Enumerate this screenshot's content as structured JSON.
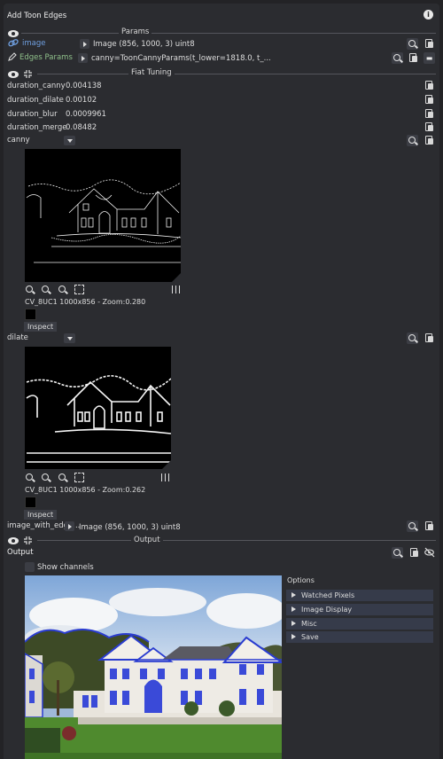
{
  "window": {
    "title": "Add Toon Edges"
  },
  "sections": {
    "params": "Params",
    "fiat_tuning": "Fiat Tuning",
    "output": "Output"
  },
  "params": [
    {
      "label": "image",
      "value": "Image (856, 1000, 3) uint8"
    },
    {
      "label": "Edges Params",
      "value": "canny=ToonCannyParams(t_lower=1818.0, t_..."
    }
  ],
  "tuning": [
    {
      "label": "duration_canny",
      "value": "0.004138"
    },
    {
      "label": "duration_dilate",
      "value": "0.00102"
    },
    {
      "label": "duration_blur",
      "value": "0.0009961"
    },
    {
      "label": "duration_merge",
      "value": "0.08482"
    }
  ],
  "canny": {
    "label": "canny",
    "info": "CV_8UC1 1000x856 - Zoom:0.280",
    "inspect": "Inspect"
  },
  "dilate": {
    "label": "dilate",
    "info": "CV_8UC1 1000x856 - Zoom:0.262",
    "inspect": "Inspect"
  },
  "image_with_edges": {
    "label": "image_with_edge...",
    "value": "Image (856, 1000, 3) uint8"
  },
  "output": {
    "label": "Output",
    "show_channels": "Show channels"
  },
  "options": {
    "title": "Options",
    "items": [
      "Watched Pixels",
      "Image Display",
      "Misc",
      "Save"
    ]
  },
  "colors": {
    "accent_blue": "#6f9fe0",
    "accent_green": "#8fc08a",
    "panel": "#2b2c30",
    "row": "#363b4a"
  },
  "icons": [
    "eye-icon",
    "link-icon",
    "pencil-icon",
    "info-icon",
    "search-icon",
    "copy-icon",
    "zoom-in-icon",
    "zoom-out-icon",
    "fit-icon",
    "tune-icon",
    "eye-off-icon"
  ]
}
